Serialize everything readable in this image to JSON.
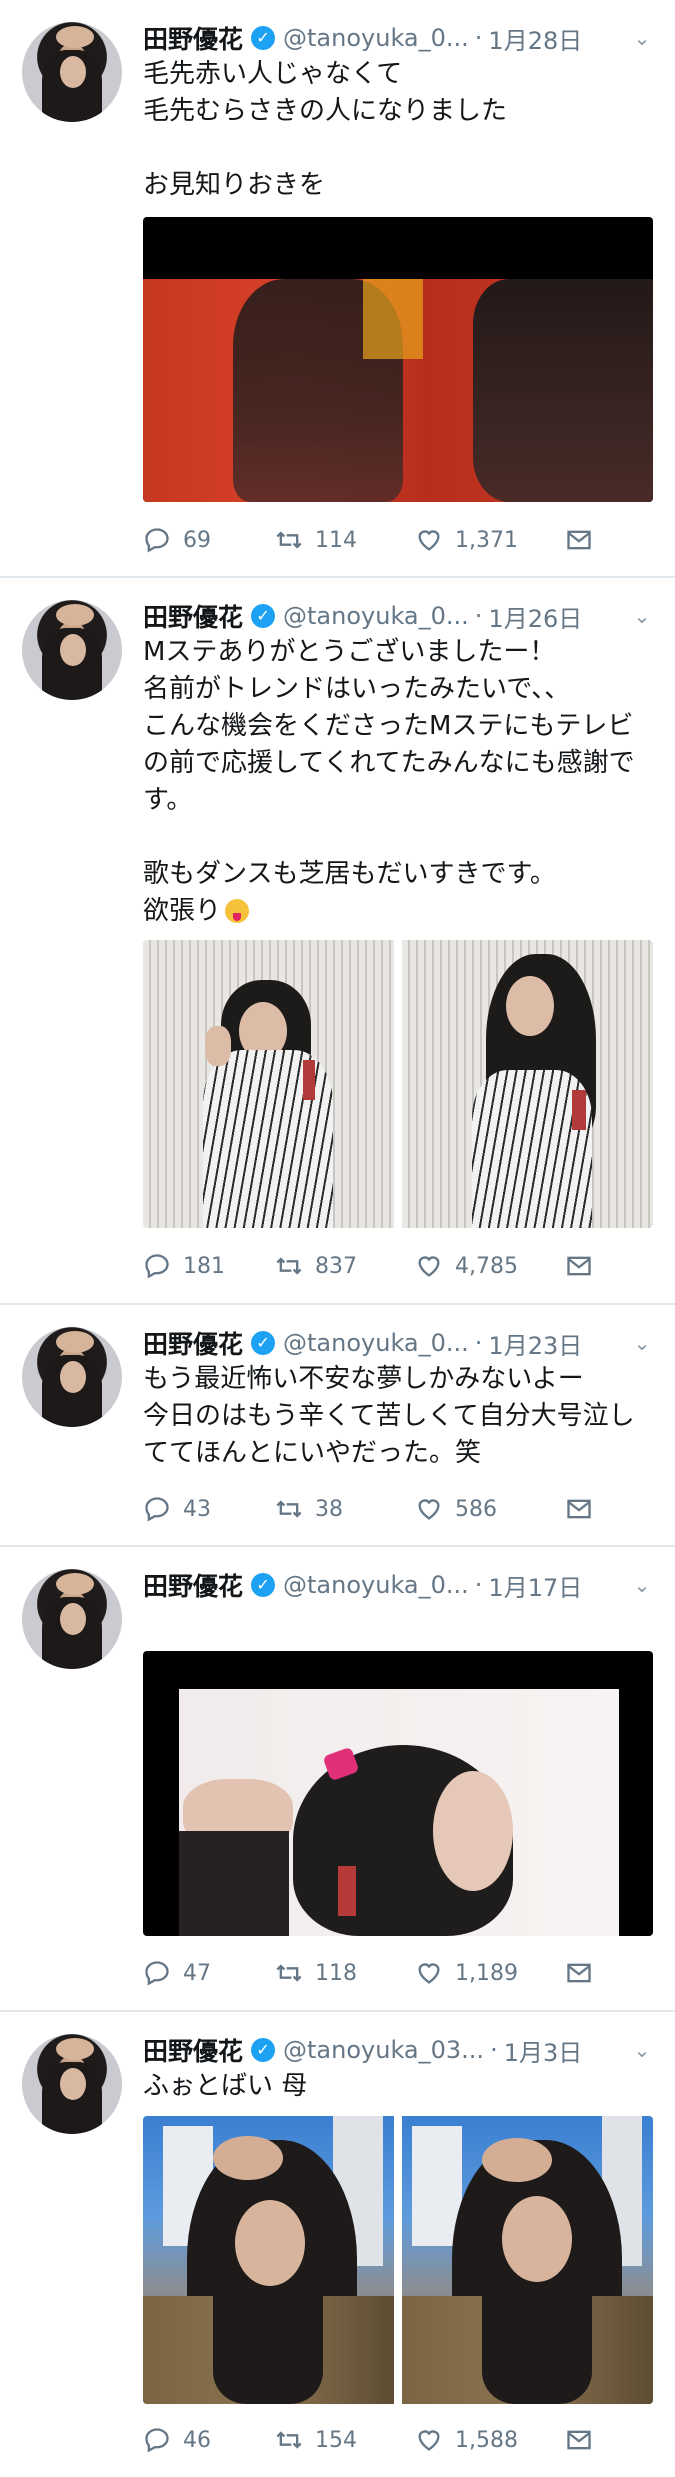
{
  "tweets": [
    {
      "name": "田野優花",
      "handle": "@tanoyuka_0...",
      "date": "1月28日",
      "text": "毛先赤い人じゃなくて\n毛先むらさきの人になりました\n\nお見知りおきを",
      "emoji": "",
      "replies": "69",
      "retweets": "114",
      "likes": "1,371"
    },
    {
      "name": "田野優花",
      "handle": "@tanoyuka_0...",
      "date": "1月26日",
      "text": "Mステありがとうございましたー！\n名前がトレンドはいったみたいで、、\nこんな機会をくださったMステにもテレビの前で応援してくれてたみんなにも感謝です。\n\n歌もダンスも芝居もだいすきです。\n欲張り",
      "emoji": "tongue-face",
      "replies": "181",
      "retweets": "837",
      "likes": "4,785"
    },
    {
      "name": "田野優花",
      "handle": "@tanoyuka_0...",
      "date": "1月23日",
      "text": "もう最近怖い不安な夢しかみないよー\n今日のはもう辛くて苦しくて自分大号泣しててほんとにいやだった。笑",
      "emoji": "",
      "replies": "43",
      "retweets": "38",
      "likes": "586"
    },
    {
      "name": "田野優花",
      "handle": "@tanoyuka_0...",
      "date": "1月17日",
      "text": "",
      "emoji": "ribbon",
      "replies": "47",
      "retweets": "118",
      "likes": "1,189"
    },
    {
      "name": "田野優花",
      "handle": "@tanoyuka_03...",
      "date": "1月3日",
      "text": "ふぉとばい 母",
      "emoji": "",
      "replies": "46",
      "retweets": "154",
      "likes": "1,588"
    }
  ],
  "colors": {
    "verified": "#1da1f2",
    "muted": "#657786",
    "divider": "#e1e8ed"
  },
  "icons": [
    "reply-icon",
    "retweet-icon",
    "like-icon",
    "dm-icon",
    "verified-badge-icon",
    "caret-down-icon"
  ]
}
